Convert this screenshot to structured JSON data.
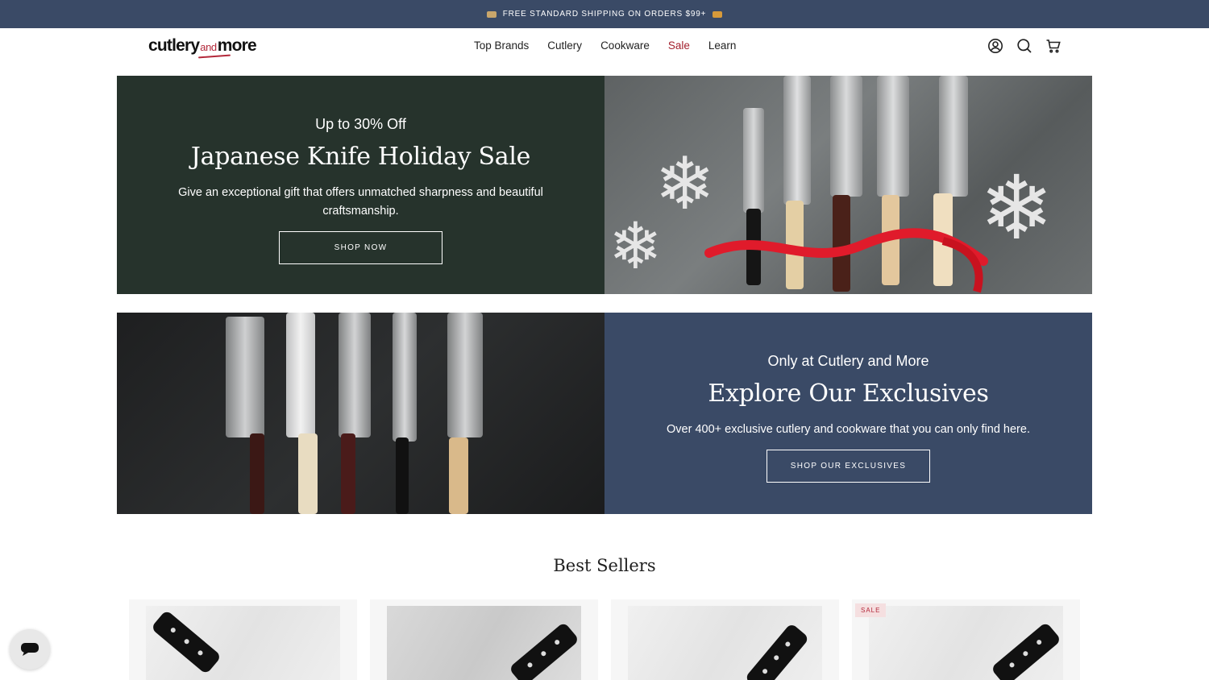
{
  "announcement": {
    "text": "FREE STANDARD SHIPPING ON ORDERS $99+"
  },
  "header": {
    "logo": {
      "part1": "cutlery",
      "part2": "and",
      "part3": "more"
    },
    "nav": [
      {
        "label": "Top Brands"
      },
      {
        "label": "Cutlery"
      },
      {
        "label": "Cookware"
      },
      {
        "label": "Sale"
      },
      {
        "label": "Learn"
      }
    ],
    "icons": [
      "account-icon",
      "search-icon",
      "cart-icon"
    ]
  },
  "hero1": {
    "pretitle": "Up to 30% Off",
    "title": "Japanese Knife Holiday Sale",
    "description": "Give an exceptional gift that offers unmatched sharpness and beautiful craftsmanship.",
    "cta": "SHOP NOW"
  },
  "hero2": {
    "pretitle": "Only at Cutlery and More",
    "title": "Explore Our Exclusives",
    "description": "Over 400+ exclusive cutlery and cookware that you can only find here.",
    "cta": "SHOP OUR EXCLUSIVES"
  },
  "best_sellers": {
    "title": "Best Sellers",
    "products": [
      {
        "badge": ""
      },
      {
        "badge": ""
      },
      {
        "badge": ""
      },
      {
        "badge": "SALE"
      }
    ]
  },
  "colors": {
    "announcement_bg": "#3a4a66",
    "hero1_panel": "#26332c",
    "hero2_panel": "#3a4a66",
    "sale_red": "#a3202e"
  }
}
